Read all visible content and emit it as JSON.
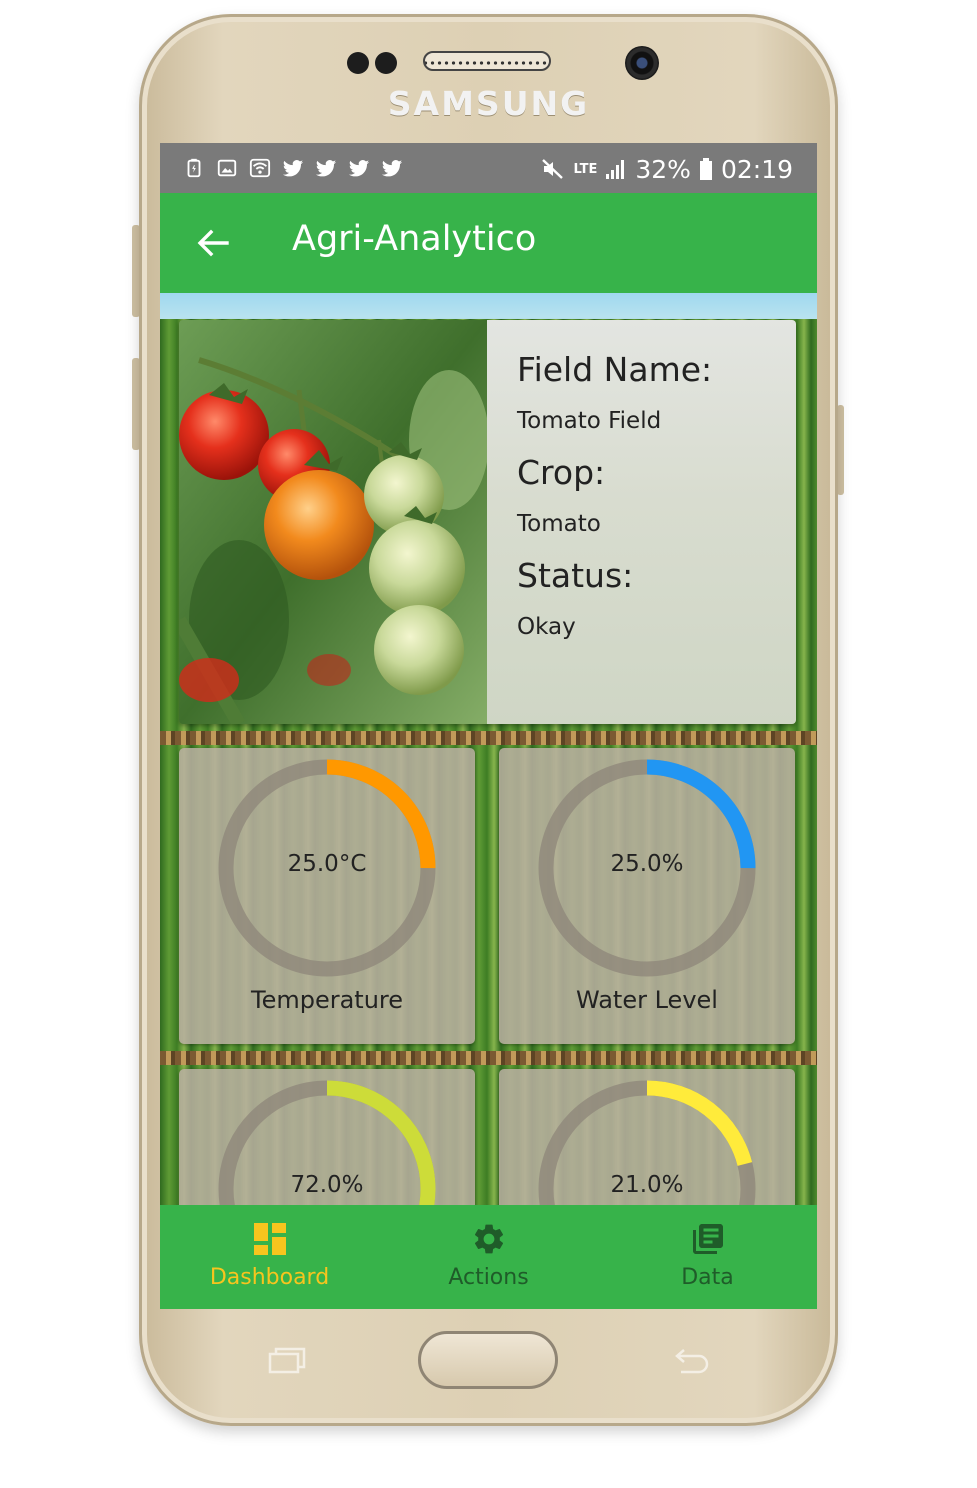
{
  "device": {
    "brand": "SAMSUNG"
  },
  "status_bar": {
    "notification_icons": [
      "battery-saver-icon",
      "image-icon",
      "wifi-icon",
      "twitter-icon",
      "twitter-icon",
      "twitter-icon",
      "twitter-icon"
    ],
    "network": "LTE",
    "battery": "32%",
    "time": "02:19"
  },
  "app_bar": {
    "title": "Agri-Analytico",
    "back_icon": "arrow-back-icon"
  },
  "field": {
    "name_heading": "Field Name:",
    "name": "Tomato Field",
    "crop_heading": "Crop:",
    "crop": "Tomato",
    "status_heading": "Status:",
    "status": "Okay"
  },
  "gauges": [
    {
      "label": "Temperature",
      "display": "25.0°C",
      "fraction": 0.25,
      "color": "#ff9800"
    },
    {
      "label": "Water Level",
      "display": "25.0%",
      "fraction": 0.25,
      "color": "#2196f3"
    },
    {
      "label": "",
      "display": "72.0%",
      "fraction": 0.72,
      "color": "#cddc39"
    },
    {
      "label": "",
      "display": "21.0%",
      "fraction": 0.21,
      "color": "#ffeb3b"
    }
  ],
  "bottom_nav": {
    "items": [
      {
        "label": "Dashboard",
        "icon": "dashboard-icon",
        "active": true
      },
      {
        "label": "Actions",
        "icon": "gear-icon",
        "active": false
      },
      {
        "label": "Data",
        "icon": "library-books-icon",
        "active": false
      }
    ]
  },
  "colors": {
    "primary": "#37b34a",
    "active_nav": "#f7c51e",
    "inactive_nav": "#1f5c29",
    "gauge_track": "#8d857a"
  }
}
